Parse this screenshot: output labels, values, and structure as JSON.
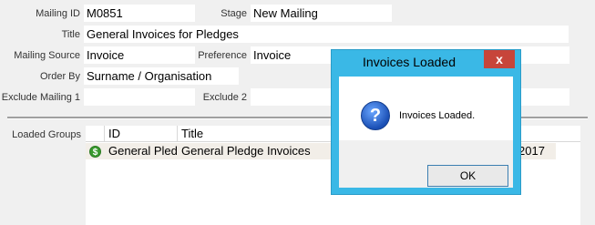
{
  "form": {
    "mailing_id_label": "Mailing ID",
    "mailing_id_value": "M0851",
    "stage_label": "Stage",
    "stage_value": "New Mailing",
    "title_label": "Title",
    "title_value": "General Invoices for Pledges",
    "mailing_source_label": "Mailing Source",
    "mailing_source_value": "Invoice",
    "preference_label": "Preference",
    "preference_value": "Invoice",
    "order_by_label": "Order By",
    "order_by_value": "Surname / Organisation",
    "exclude_mailing_1_label": "Exclude Mailing 1",
    "exclude_mailing_1_value": "",
    "exclude_2_label": "Exclude 2",
    "exclude_2_value": ""
  },
  "loaded_groups": {
    "label": "Loaded Groups",
    "columns": [
      "ID",
      "Title"
    ],
    "rows": [
      {
        "id": "General Pled",
        "title": "General Pledge Invoices",
        "trailing": "2017",
        "status_icon": "green-dollar-icon"
      }
    ]
  },
  "dialog": {
    "title": "Invoices Loaded",
    "close_glyph": "x",
    "icon": "question-icon",
    "message": "Invoices Loaded.",
    "ok_label": "OK",
    "accent_color": "#3ab8e6",
    "close_color": "#c7453a"
  }
}
